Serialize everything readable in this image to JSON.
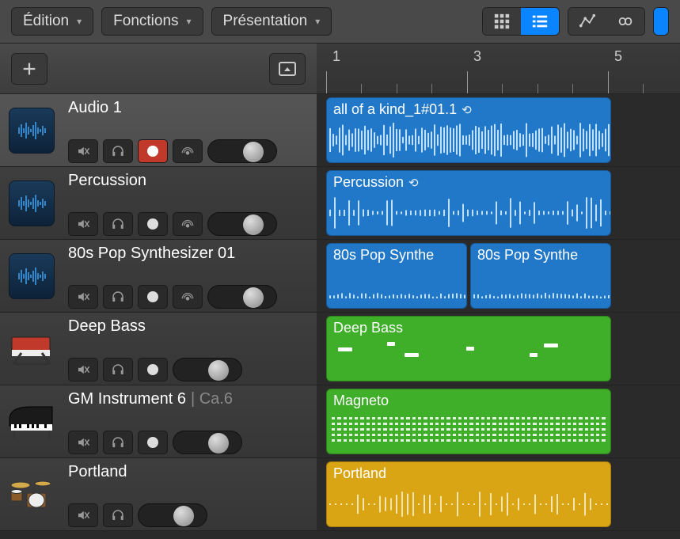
{
  "toolbar": {
    "edit": "Édition",
    "functions": "Fonctions",
    "presentation": "Présentation"
  },
  "ruler": {
    "marks": [
      "1",
      "3",
      "5"
    ]
  },
  "tracks": [
    {
      "name": "Audio 1",
      "suffix": "",
      "iconType": "audio",
      "selected": true,
      "controls": {
        "mute": true,
        "solo": true,
        "rec": "red",
        "input": true,
        "pan": 0.72
      }
    },
    {
      "name": "Percussion",
      "suffix": "",
      "iconType": "audio",
      "selected": false,
      "controls": {
        "mute": true,
        "solo": true,
        "rec": "white",
        "input": true,
        "pan": 0.72
      }
    },
    {
      "name": "80s Pop Synthesizer 01",
      "suffix": "",
      "iconType": "audio",
      "selected": false,
      "controls": {
        "mute": true,
        "solo": true,
        "rec": "white",
        "input": true,
        "pan": 0.72
      }
    },
    {
      "name": "Deep Bass",
      "suffix": "",
      "iconType": "synth",
      "selected": false,
      "controls": {
        "mute": true,
        "solo": true,
        "rec": "white",
        "input": false,
        "pan": 0.72
      }
    },
    {
      "name": "GM Instrument 6",
      "suffix": "| Ca.6",
      "iconType": "piano",
      "selected": false,
      "controls": {
        "mute": true,
        "solo": true,
        "rec": "white",
        "input": false,
        "pan": 0.72
      }
    },
    {
      "name": "Portland",
      "suffix": "",
      "iconType": "drums",
      "selected": false,
      "controls": {
        "mute": true,
        "solo": true,
        "rec": null,
        "input": false,
        "pan": 0.72
      }
    }
  ],
  "regions": [
    [
      {
        "label": "all of a kind_1#01.1",
        "loop": true,
        "color": "blue",
        "start": 0,
        "len": 360,
        "wave": "dense"
      }
    ],
    [
      {
        "label": "Percussion",
        "loop": true,
        "color": "blue",
        "start": 0,
        "len": 360,
        "wave": "sparse"
      }
    ],
    [
      {
        "label": "80s Pop Synthe",
        "loop": false,
        "color": "blue",
        "start": 0,
        "len": 178,
        "wave": "tiny"
      },
      {
        "label": "80s Pop Synthe",
        "loop": false,
        "color": "blue",
        "start": 182,
        "len": 178,
        "wave": "tiny"
      }
    ],
    [
      {
        "label": "Deep Bass",
        "loop": false,
        "color": "green",
        "start": 0,
        "len": 360,
        "wave": "bass"
      }
    ],
    [
      {
        "label": "Magneto",
        "loop": false,
        "color": "green",
        "start": 0,
        "len": 360,
        "wave": "dots"
      }
    ],
    [
      {
        "label": "Portland",
        "loop": false,
        "color": "yellow",
        "start": 0,
        "len": 360,
        "wave": "drums"
      }
    ]
  ],
  "colors": {
    "blue": "#2178c8",
    "green": "#3fae29",
    "yellow": "#d9a514",
    "accent": "#0a84ff"
  }
}
